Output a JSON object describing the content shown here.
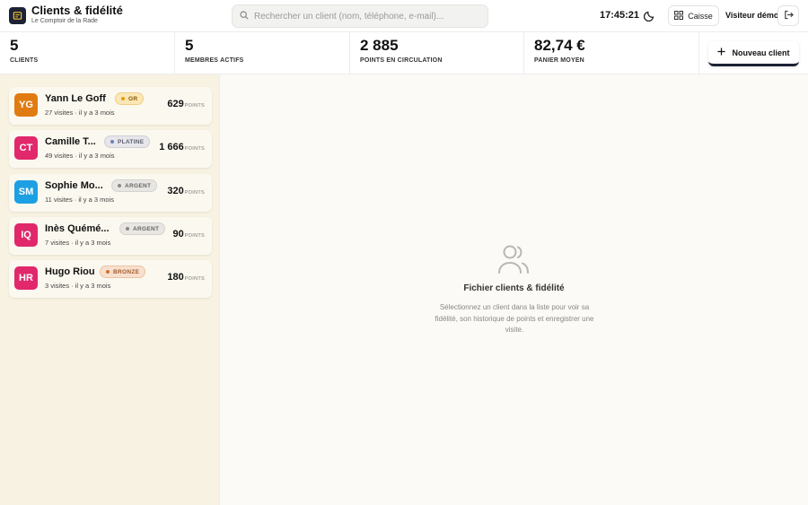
{
  "header": {
    "title": "Clients & fidélité",
    "subtitle": "Le Comptoir de la Rade",
    "search_placeholder": "Rechercher un client (nom, téléphone, e-mail)...",
    "clock": "17:45:21",
    "caisse_label": "Caisse",
    "user_name": "Visiteur démo"
  },
  "stats": [
    {
      "value": "5",
      "label": "CLIENTS"
    },
    {
      "value": "5",
      "label": "MEMBRES ACTIFS"
    },
    {
      "value": "2 885",
      "label": "POINTS EN CIRCULATION"
    },
    {
      "value": "82,74 €",
      "label": "PANIER MOYEN"
    }
  ],
  "new_client_label": "Nouveau client",
  "clients": [
    {
      "initials": "YG",
      "name": "Yann Le Goff",
      "tier": "OR",
      "meta": "27 visites · il y a 3 mois",
      "points": "629",
      "points_unit": "POINTS",
      "avatar_color": "#e07b12",
      "tier_bg": "#fbe7b6",
      "tier_fg": "#8a5a00",
      "tier_dot": "#e89a10",
      "tier_border": "#f0cf80"
    },
    {
      "initials": "CT",
      "name": "Camille T...",
      "tier": "PLATINE",
      "meta": "49 visites · il y a 3 mois",
      "points": "1 666",
      "points_unit": "POINTS",
      "avatar_color": "#e0286a",
      "tier_bg": "#e7e6ea",
      "tier_fg": "#5b6170",
      "tier_dot": "#6a82b8",
      "tier_border": "#cfcfd6"
    },
    {
      "initials": "SM",
      "name": "Sophie Mo...",
      "tier": "ARGENT",
      "meta": "11 visites · il y a 3 mois",
      "points": "320",
      "points_unit": "POINTS",
      "avatar_color": "#1da0e3",
      "tier_bg": "#e8e6e3",
      "tier_fg": "#666",
      "tier_dot": "#888",
      "tier_border": "#d4d2cf"
    },
    {
      "initials": "IQ",
      "name": "Inès Quémé...",
      "tier": "ARGENT",
      "meta": "7 visites · il y a 3 mois",
      "points": "90",
      "points_unit": "POINTS",
      "avatar_color": "#e0286a",
      "tier_bg": "#e8e6e3",
      "tier_fg": "#666",
      "tier_dot": "#888",
      "tier_border": "#d4d2cf"
    },
    {
      "initials": "HR",
      "name": "Hugo Riou",
      "tier": "BRONZE",
      "meta": "3 visites · il y a 3 mois",
      "points": "180",
      "points_unit": "POINTS",
      "avatar_color": "#e0286a",
      "tier_bg": "#f8e0cf",
      "tier_fg": "#a35a2a",
      "tier_dot": "#d3702e",
      "tier_border": "#ecc3a5"
    }
  ],
  "empty_state": {
    "icon": "users-icon",
    "title": "Fichier clients & fidélité",
    "text": "Sélectionnez un client dans la liste pour voir sa fidélité, son historique de points et enregistrer une visite."
  }
}
